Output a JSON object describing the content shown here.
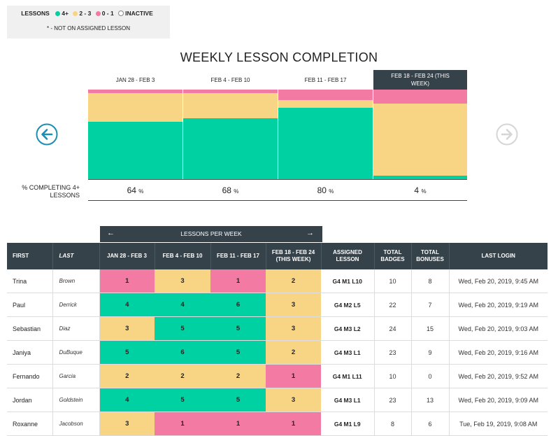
{
  "colors": {
    "green": "#00d1a2",
    "yellow": "#f7d584",
    "pink": "#f27aa3",
    "dark": "#36424a"
  },
  "legend": {
    "title": "LESSONS",
    "items": [
      {
        "label": "4+",
        "color": "#00d1a2"
      },
      {
        "label": "2 - 3",
        "color": "#f7d584"
      },
      {
        "label": "0 - 1",
        "color": "#f27aa3"
      },
      {
        "label": "INACTIVE",
        "color": "#ffffff"
      }
    ],
    "note": "* - NOT ON ASSIGNED LESSON"
  },
  "chart": {
    "title": "WEEKLY LESSON COMPLETION",
    "pct_label": "% COMPLETING 4+ LESSONS",
    "weeks": [
      {
        "label": "JAN 28 - FEB 3",
        "green": 64,
        "yellow": 32,
        "pink": 4,
        "pct": "64",
        "current": false
      },
      {
        "label": "FEB 4 - FEB 10",
        "green": 68,
        "yellow": 28,
        "pink": 4,
        "pct": "68",
        "current": false
      },
      {
        "label": "FEB 11 - FEB 17",
        "green": 80,
        "yellow": 8,
        "pink": 12,
        "pct": "80",
        "current": false
      },
      {
        "label": "FEB 18 - FEB 24 (THIS WEEK)",
        "green": 4,
        "yellow": 80,
        "pink": 16,
        "pct": "4",
        "current": true
      }
    ]
  },
  "table": {
    "toolbar_title": "LESSONS PER WEEK",
    "headers": [
      "FIRST",
      "LAST",
      "JAN 28 - FEB 3",
      "FEB 4 - FEB 10",
      "FEB 11 - FEB 17",
      "FEB 18 - FEB 24 (THIS WEEK)",
      "ASSIGNED LESSON",
      "TOTAL BADGES",
      "TOTAL BONUSES",
      "LAST LOGIN"
    ],
    "rows": [
      {
        "first": "Trina",
        "last": "Brown",
        "weeks": [
          1,
          3,
          1,
          2
        ],
        "assigned": "G4 M1 L10",
        "badges": "10",
        "bonuses": "8",
        "login": "Wed, Feb 20, 2019, 9:45 AM"
      },
      {
        "first": "Paul",
        "last": "Derrick",
        "weeks": [
          4,
          4,
          6,
          3
        ],
        "assigned": "G4 M2 L5",
        "badges": "22",
        "bonuses": "7",
        "login": "Wed, Feb 20, 2019, 9:19 AM"
      },
      {
        "first": "Sebastian",
        "last": "Diaz",
        "weeks": [
          3,
          5,
          5,
          3
        ],
        "assigned": "G4 M3 L2",
        "badges": "24",
        "bonuses": "15",
        "login": "Wed, Feb 20, 2019, 9:03 AM"
      },
      {
        "first": "Janiya",
        "last": "DuBuque",
        "weeks": [
          5,
          6,
          5,
          2
        ],
        "assigned": "G4 M3 L1",
        "badges": "23",
        "bonuses": "9",
        "login": "Wed, Feb 20, 2019, 9:16 AM"
      },
      {
        "first": "Fernando",
        "last": "Garcia",
        "weeks": [
          2,
          2,
          2,
          1
        ],
        "assigned": "G4 M1 L11",
        "badges": "10",
        "bonuses": "0",
        "login": "Wed, Feb 20, 2019, 9:52 AM"
      },
      {
        "first": "Jordan",
        "last": "Goldstein",
        "weeks": [
          4,
          5,
          5,
          3
        ],
        "assigned": "G4 M3 L1",
        "badges": "23",
        "bonuses": "13",
        "login": "Wed, Feb 20, 2019, 9:09 AM"
      },
      {
        "first": "Roxanne",
        "last": "Jacobson",
        "weeks": [
          3,
          1,
          1,
          1
        ],
        "assigned": "G4 M1 L9",
        "badges": "8",
        "bonuses": "6",
        "login": "Tue, Feb 19, 2019, 9:08 AM"
      }
    ]
  }
}
